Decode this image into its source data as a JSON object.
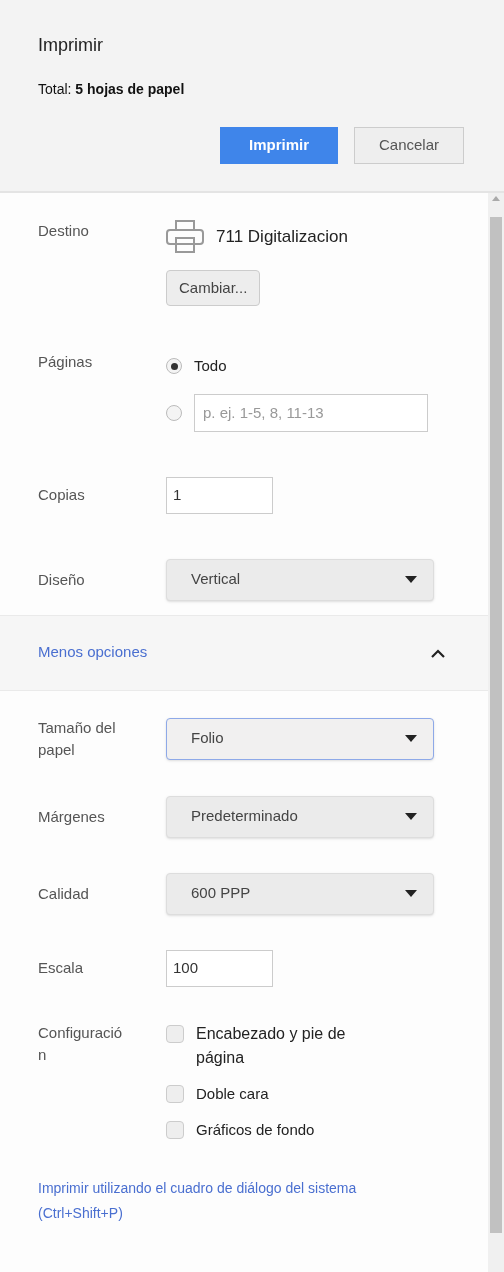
{
  "header": {
    "title": "Imprimir",
    "total": "Total: **5 hojas de papel**",
    "buttons": [
      {
        "label": "Imprimir",
        "kind": "primary"
      },
      {
        "label": "Cancelar",
        "kind": "secondary"
      }
    ]
  },
  "settings": [
    {
      "kind": "destination",
      "label": "Destino",
      "value": "711 Digitalizacion",
      "button": "Cambiar..."
    },
    {
      "kind": "pages",
      "label": "Páginas",
      "options": [
        {
          "kind": "text",
          "label": "Todo",
          "selected": true
        },
        {
          "kind": "input",
          "placeholder": "p. ej. 1-5, 8, 11-13",
          "selected": false
        }
      ]
    },
    {
      "kind": "input",
      "label": "Copias",
      "value": "1"
    },
    {
      "kind": "select",
      "label": "Diseño",
      "value": "Vertical",
      "focused": false
    }
  ],
  "more_options": {
    "label": "Menos opciones",
    "expanded": true
  },
  "advanced": [
    {
      "kind": "select",
      "label": "Tamaño del papel",
      "value": "Folio",
      "focused": true
    },
    {
      "kind": "select",
      "label": "Márgenes",
      "value": "Predeterminado",
      "focused": false
    },
    {
      "kind": "select",
      "label": "Calidad",
      "value": "600 PPP",
      "focused": false
    },
    {
      "kind": "input",
      "label": "Escala",
      "value": "100"
    },
    {
      "kind": "checkboxes",
      "label": "Configuración",
      "options": [
        {
          "label": "Encabezado y pie de página",
          "checked": false
        },
        {
          "label": "Doble cara",
          "checked": false
        },
        {
          "label": "Gráficos de fondo",
          "checked": false
        }
      ]
    }
  ],
  "system_dialog_link": "Imprimir utilizando el cuadro de diálogo del sistema (Ctrl+Shift+P)"
}
